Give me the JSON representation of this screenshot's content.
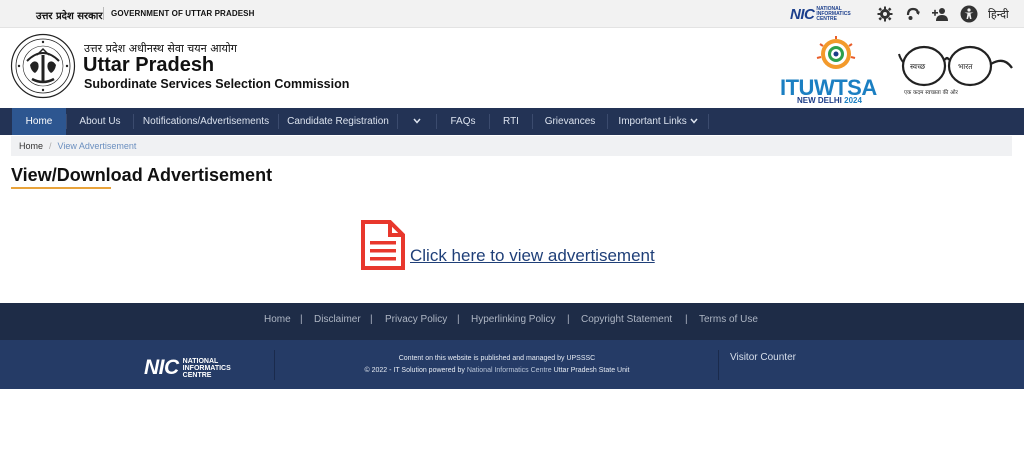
{
  "topbar": {
    "gov_hindi": "उत्तर प्रदेश सरकार",
    "gov_english": "GOVERNMENT OF UTTAR PRADESH",
    "nic_logo": "NIC",
    "nic_logo_sub": [
      "NATIONAL",
      "INFORMATICS",
      "CENTRE"
    ],
    "icons": [
      "gear-icon",
      "screen-reader-icon",
      "sitemap-icon",
      "accessibility-icon"
    ],
    "language_link": "हिन्दी"
  },
  "header": {
    "org_hindi": "उत्तर प्रदेश अधीनस्थ सेवा चयन आयोग",
    "org_name": "Uttar Pradesh",
    "org_subtitle": "Subordinate Services Selection Commission",
    "event_logo_text": "ITUWTSA",
    "event_city": "NEW DELHI",
    "event_year": "2024",
    "swachh_left": "स्वच्छ",
    "swachh_right": "भारत",
    "swachh_tagline": "एक कदम स्वच्छता की ओर"
  },
  "nav": {
    "items": [
      {
        "label": "Home",
        "active": true
      },
      {
        "label": "About Us",
        "active": false
      },
      {
        "label": "Notifications/Advertisements",
        "active": false
      },
      {
        "label": "Candidate Registration",
        "active": false
      },
      {
        "label": "",
        "active": false
      },
      {
        "label": "FAQs",
        "active": false
      },
      {
        "label": "RTI",
        "active": false
      },
      {
        "label": "Grievances",
        "active": false
      },
      {
        "label": "Important Links",
        "active": false
      }
    ]
  },
  "breadcrumb": {
    "home": "Home",
    "current": "View Advertisement"
  },
  "main": {
    "title": "View/Download Advertisement",
    "link_text": "Click here to view advertisement"
  },
  "footer": {
    "links": [
      "Home",
      "Disclaimer",
      "Privacy Policy",
      "Hyperlinking Policy",
      "Copyright Statement",
      "Terms of Use"
    ],
    "nic_logo": "NIC",
    "nic_logo_sub": [
      "NATIONAL",
      "INFORMATICS",
      "CENTRE"
    ],
    "line1": "Content on this website is published and managed by UPSSSC",
    "line2_prefix": "© 2022 - IT Solution powered by",
    "line2_nic": "National Informatics Centre",
    "line2_suffix": "Uttar Pradesh State Unit",
    "visitor_counter": "Visitor Counter"
  },
  "colors": {
    "navbar": "#233355",
    "nav_active": "#2d5690",
    "footer_links_bg": "#1e2c47",
    "footer_bottom_bg": "#253b66",
    "title_underline": "#e8a33b",
    "doc_icon": "#e8372c",
    "link": "#1f3f78"
  }
}
